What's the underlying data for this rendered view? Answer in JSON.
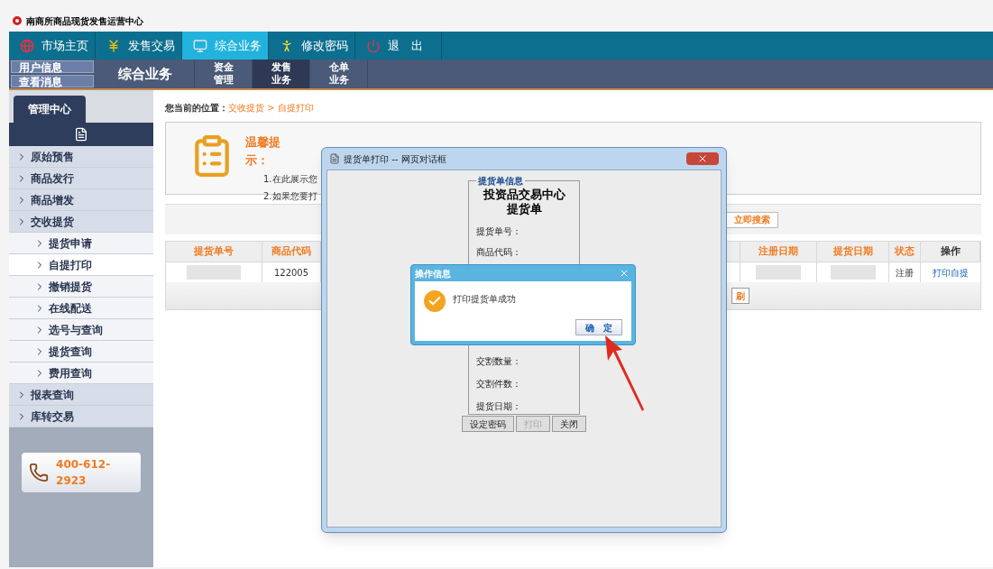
{
  "app_title": "南商所商品现货发售运营中心",
  "nav": [
    {
      "label": "市场主页",
      "kind": "home",
      "selected": false
    },
    {
      "label": "发售交易",
      "kind": "trade",
      "selected": false
    },
    {
      "label": "综合业务",
      "kind": "business",
      "selected": true
    },
    {
      "label": "修改密码",
      "kind": "password",
      "selected": false
    },
    {
      "label": "退　出",
      "kind": "logout",
      "selected": false
    }
  ],
  "user_links": [
    "用户信息",
    "查看消息"
  ],
  "section_title": "综合业务",
  "sub_tabs": [
    {
      "label": "资金管理",
      "selected": false
    },
    {
      "label": "发售业务",
      "selected": true
    },
    {
      "label": "仓单业务",
      "selected": false
    }
  ],
  "sidebar": {
    "tab": "管理中心",
    "items": [
      {
        "label": "原始预售",
        "selected": false
      },
      {
        "label": "商品发行",
        "selected": false
      },
      {
        "label": "商品增发",
        "selected": false
      },
      {
        "label": "交收提货",
        "selected": false,
        "children": [
          {
            "label": "提货申请",
            "selected": false
          },
          {
            "label": "自提打印",
            "selected": true
          },
          {
            "label": "撤销提货",
            "selected": false
          },
          {
            "label": "在线配送",
            "selected": false
          },
          {
            "label": "选号与查询",
            "selected": false
          },
          {
            "label": "提货查询",
            "selected": false
          },
          {
            "label": "费用查询",
            "selected": false
          }
        ]
      },
      {
        "label": "报表查询",
        "selected": false
      },
      {
        "label": "库转交易",
        "selected": false
      }
    ]
  },
  "phone": "400-612-2923",
  "breadcrumb": {
    "label": "您当前的位置：",
    "path": "交收提货 > 自提打印"
  },
  "tip": {
    "title": "温馨提示：",
    "lines": [
      "1.在此展示您",
      "2.如果您要打"
    ]
  },
  "search_button": "立即搜索",
  "table": {
    "columns": [
      "提货单号",
      "商品代码",
      "注册日期",
      "提货日期",
      "状态",
      "操作"
    ],
    "rows": [
      {
        "code": "122005",
        "status": "注册",
        "action": "打印自提"
      }
    ]
  },
  "bottom_button": "刷",
  "dialog": {
    "title": "提货单打印 -- 网页对话框",
    "legend": "提货单信息",
    "heading": "投资品交易中心",
    "subheading": "提货单",
    "fields_top": [
      "提货单号：",
      "商品代码："
    ],
    "fields_bottom": [
      "交割数量：",
      "交割件数：",
      "提货日期："
    ],
    "buttons": [
      {
        "label": "设定密码",
        "disabled": false
      },
      {
        "label": "打印",
        "disabled": true
      },
      {
        "label": "关闭",
        "disabled": false
      }
    ]
  },
  "alert": {
    "title": "操作信息",
    "message": "打印提货单成功",
    "button": "确　定"
  }
}
